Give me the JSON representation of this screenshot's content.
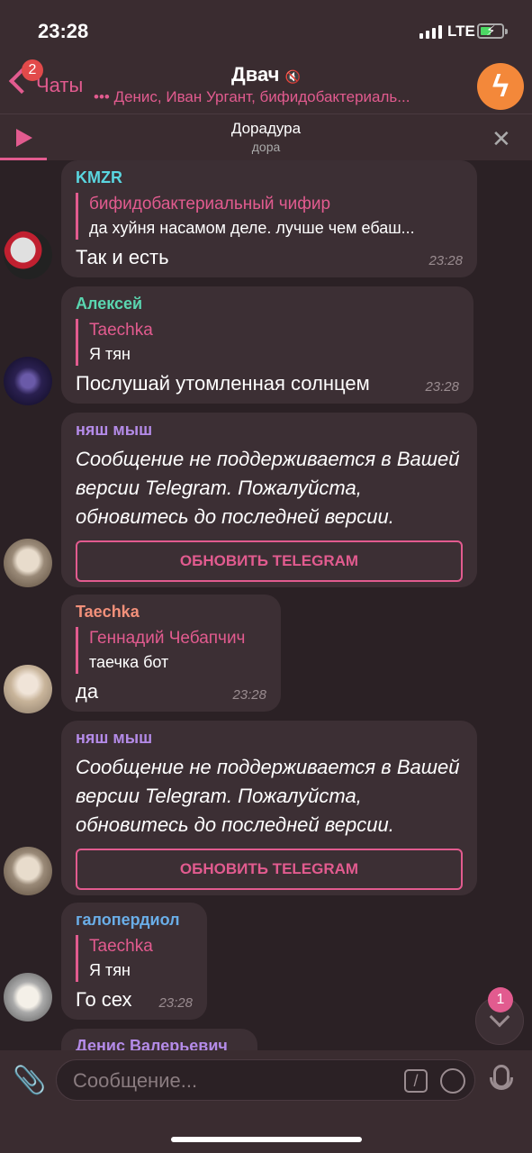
{
  "status_bar": {
    "time": "23:28",
    "network": "LTE"
  },
  "nav": {
    "back_label": "Чаты",
    "unread_count": "2",
    "title": "Двач",
    "mute_glyph": "🔇",
    "subtitle": "••• Денис, Иван Ургант, бифидобактериаль..."
  },
  "pinned": {
    "title": "Дорадура",
    "subtitle": "дора"
  },
  "messages": [
    {
      "sender": "KMZR",
      "sender_color": "#5ad6e0",
      "reply_name": "бифидобактериальный чифир",
      "reply_text": "да хуйня насамом деле. лучше чем ебаш...",
      "text": "Так и есть",
      "time": "23:28"
    },
    {
      "sender": "Алексей",
      "sender_color": "#5ad6b0",
      "reply_name": "Taechka",
      "reply_text": "Я тян",
      "text": "Послушай утомленная солнцем",
      "time": "23:28"
    },
    {
      "sender": "няш мыш",
      "sender_color": "#b48be8",
      "text": "Сообщение не поддерживается в Вашей версии Telegram. Пожалуйста, обновитесь до последней версии.",
      "button": "ОБНОВИТЬ TELEGRAM"
    },
    {
      "sender": "Taechka",
      "sender_color": "#f2907a",
      "reply_name": "Геннадий Чебапчич",
      "reply_text": "таечка бот",
      "text": "да",
      "time": "23:28"
    },
    {
      "sender": "няш мыш",
      "sender_color": "#b48be8",
      "text": "Сообщение не поддерживается в Вашей версии Telegram. Пожалуйста, обновитесь до последней версии.",
      "button": "ОБНОВИТЬ TELEGRAM"
    },
    {
      "sender": "галопердиол",
      "sender_color": "#6aaee8",
      "reply_name": "Taechka",
      "reply_text": "Я тян",
      "text": "Го сех",
      "time": "23:28"
    },
    {
      "sender": "Денис Валерьевич",
      "sender_color": "#b48be8"
    }
  ],
  "scroll_badge": "1",
  "input": {
    "placeholder": "Сообщение..."
  },
  "colors": {
    "accent": "#e25b8f",
    "background": "#2b2125",
    "bubble": "#3c2f34",
    "header": "#3a2c30"
  }
}
